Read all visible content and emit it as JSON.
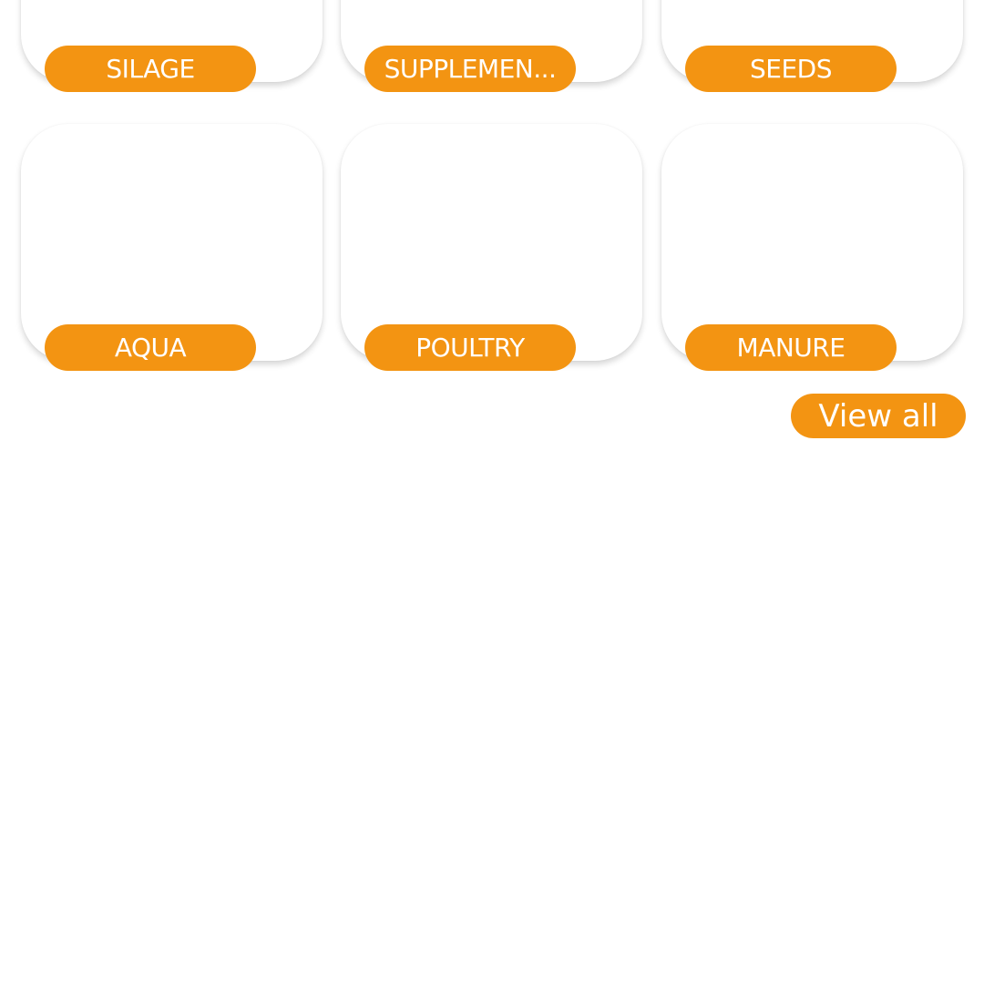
{
  "theme": {
    "accent": "#F39412",
    "card_background": "#FFFFFF"
  },
  "categories": [
    {
      "label": "SILAGE"
    },
    {
      "label": "SUPPLEMEN..."
    },
    {
      "label": "SEEDS"
    },
    {
      "label": "AQUA"
    },
    {
      "label": "POULTRY"
    },
    {
      "label": "MANURE"
    }
  ],
  "view_all": {
    "label": "View all"
  }
}
